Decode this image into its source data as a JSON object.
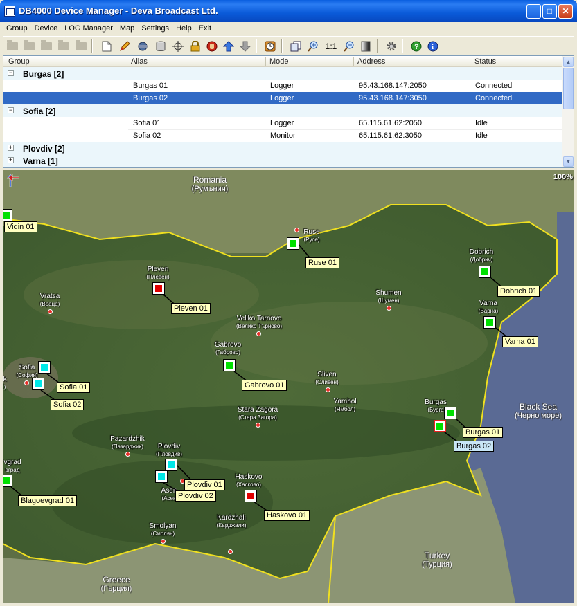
{
  "window": {
    "title": "DB4000 Device Manager - Deva Broadcast Ltd.",
    "minimize": "_",
    "maximize": "□",
    "close": "✕"
  },
  "menu": [
    "Group",
    "Device",
    "LOG Manager",
    "Map",
    "Settings",
    "Help",
    "Exit"
  ],
  "toolbar": {
    "zoom_ratio": "1:1",
    "icons": [
      "folder-icon",
      "folder-icon",
      "folder-icon",
      "folder-icon",
      "folder-icon",
      "new-document-icon",
      "pencil-icon",
      "network-icon",
      "database-icon",
      "target-icon",
      "lock-icon",
      "stop-hand-icon",
      "arrow-up-icon",
      "arrow-down-icon",
      "clock-icon",
      "copy-icon",
      "zoom-in-icon",
      "zoom-out-icon",
      "gradient-icon",
      "gear-icon",
      "help-icon",
      "info-icon"
    ]
  },
  "grid": {
    "columns": [
      "Group",
      "Alias",
      "Mode",
      "Address",
      "Status"
    ],
    "rows": [
      {
        "type": "group",
        "name": "Burgas  [2]",
        "expander": "−"
      },
      {
        "type": "device",
        "alias": "Burgas 01",
        "mode": "Logger",
        "address": "95.43.168.147:2050",
        "status": "Connected"
      },
      {
        "type": "device",
        "alias": "Burgas 02",
        "mode": "Logger",
        "address": "95.43.168.147:3050",
        "status": "Connected",
        "selected": true
      },
      {
        "type": "group",
        "name": "Sofia  [2]",
        "expander": "−"
      },
      {
        "type": "device",
        "alias": "Sofia 01",
        "mode": "Logger",
        "address": "65.115.61.62:2050",
        "status": "Idle"
      },
      {
        "type": "device",
        "alias": "Sofia 02",
        "mode": "Monitor",
        "address": "65.115.61.62:3050",
        "status": "Idle"
      },
      {
        "type": "group",
        "name": "Plovdiv  [2]",
        "expander": "+"
      },
      {
        "type": "group",
        "name": "Varna  [1]",
        "expander": "+"
      }
    ],
    "scroll_up": "▲",
    "scroll_down": "▼"
  },
  "map": {
    "zoom": "100%",
    "countries": [
      {
        "name": "Romania",
        "cyr": "(Румъния)"
      },
      {
        "name": "Black Sea",
        "cyr": "(Черно море)"
      },
      {
        "name": "Turkey",
        "cyr": "(Турция)"
      },
      {
        "name": "Greece",
        "cyr": "(Гърция)"
      }
    ],
    "cities": [
      {
        "name": "Ruse",
        "cyr": "(Русе)"
      },
      {
        "name": "Dobrich",
        "cyr": "(Добрич)"
      },
      {
        "name": "Pleven",
        "cyr": "(Плевен)"
      },
      {
        "name": "Vratsa",
        "cyr": "(Враца)"
      },
      {
        "name": "Shumen",
        "cyr": "(Шумен)"
      },
      {
        "name": "Varna",
        "cyr": "(Варна)"
      },
      {
        "name": "Veliko Tarnovo",
        "cyr": "(Велико Търново)"
      },
      {
        "name": "Gabrovo",
        "cyr": "(Габрово)"
      },
      {
        "name": "Sofia",
        "cyr": "(София)"
      },
      {
        "name": "Sliven",
        "cyr": "(Сливен)"
      },
      {
        "name": "Yambol",
        "cyr": "(Ямбол)"
      },
      {
        "name": "Burgas",
        "cyr": "(Бурга"
      },
      {
        "name": "Stara Zagora",
        "cyr": "(Стара Загора)"
      },
      {
        "name": "Pazardzhik",
        "cyr": "(Пазарджик)"
      },
      {
        "name": "Plovdiv",
        "cyr": "(Пловдив)"
      },
      {
        "name": "Haskovo",
        "cyr": "(Хасково)"
      },
      {
        "name": "Asen",
        "cyr": "(Асен"
      },
      {
        "name": "Kardzhali",
        "cyr": "(Кърджали)"
      },
      {
        "name": "Smolyan",
        "cyr": "(Смолян)"
      },
      {
        "name": "vgrad",
        "cyr": "вград"
      },
      {
        "name": "k",
        "cyr": ")"
      }
    ],
    "devices": [
      {
        "label": "Vidin 01",
        "color": "#00e000"
      },
      {
        "label": "Ruse 01",
        "color": "#00e000"
      },
      {
        "label": "Dobrich 01",
        "color": "#00e000"
      },
      {
        "label": "Pleven 01",
        "color": "#e00000"
      },
      {
        "label": "Varna 01",
        "color": "#00e000"
      },
      {
        "label": "Gabrovo 01",
        "color": "#00e000"
      },
      {
        "label": "Sofia 01",
        "color": "#00e8e8"
      },
      {
        "label": "Sofia 02",
        "color": "#00e8e8"
      },
      {
        "label": "Burgas 01",
        "color": "#00e000"
      },
      {
        "label": "Burgas 02",
        "color": "#00e000",
        "selected": true
      },
      {
        "label": "Plovdiv 01",
        "color": "#00e8e8"
      },
      {
        "label": "Plovdiv 02",
        "color": "#00e8e8"
      },
      {
        "label": "Haskovo 01",
        "color": "#e00000"
      },
      {
        "label": "Blagoevgrad 01",
        "color": "#00e000"
      }
    ]
  }
}
